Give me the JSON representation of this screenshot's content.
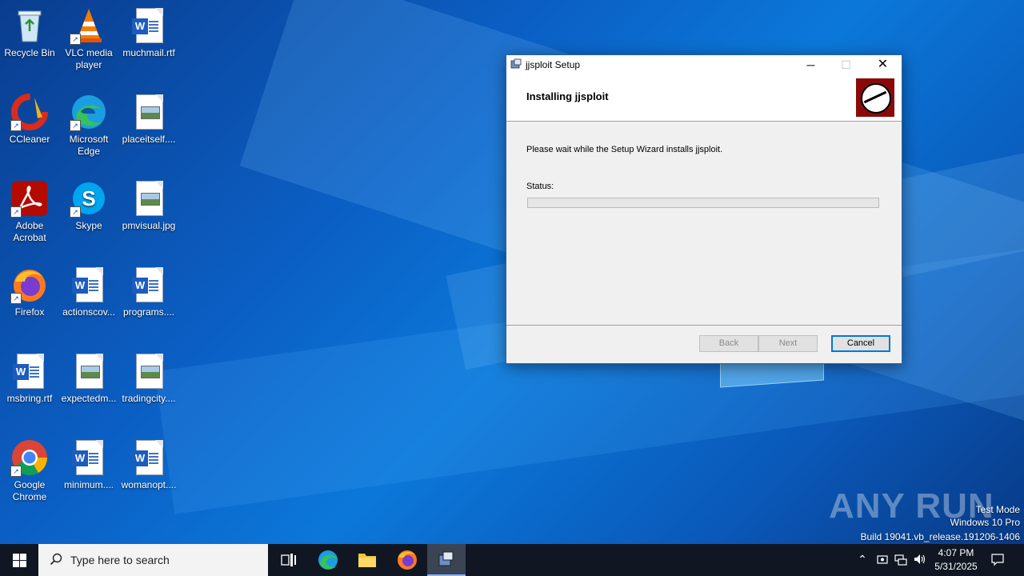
{
  "desktop": {
    "icons": [
      {
        "label": "Recycle Bin",
        "icon": "recycle-bin-icon"
      },
      {
        "label": "VLC media player",
        "icon": "vlc-icon"
      },
      {
        "label": "muchmail.rtf",
        "icon": "word-doc-icon"
      },
      {
        "label": "CCleaner",
        "icon": "ccleaner-icon"
      },
      {
        "label": "Microsoft Edge",
        "icon": "edge-icon"
      },
      {
        "label": "placeitself....",
        "icon": "image-file-icon"
      },
      {
        "label": "Adobe Acrobat",
        "icon": "acrobat-icon"
      },
      {
        "label": "Skype",
        "icon": "skype-icon"
      },
      {
        "label": "pmvisual.jpg",
        "icon": "image-file-icon"
      },
      {
        "label": "Firefox",
        "icon": "firefox-icon"
      },
      {
        "label": "actionscov...",
        "icon": "word-doc-icon"
      },
      {
        "label": "programs....",
        "icon": "word-doc-icon"
      },
      {
        "label": "msbring.rtf",
        "icon": "word-doc-icon"
      },
      {
        "label": "expectedm...",
        "icon": "image-file-icon"
      },
      {
        "label": "tradingcity....",
        "icon": "image-file-icon"
      },
      {
        "label": "Google Chrome",
        "icon": "chrome-icon"
      },
      {
        "label": "minimum....",
        "icon": "word-doc-icon"
      },
      {
        "label": "womanopt....",
        "icon": "word-doc-icon"
      }
    ]
  },
  "window": {
    "title": "jjsploit Setup",
    "header_title": "Installing jjsploit",
    "body_text": "Please wait while the Setup Wizard installs jjsploit.",
    "status_label": "Status:",
    "progress_fraction": 0,
    "buttons": {
      "back": "Back",
      "next": "Next",
      "cancel": "Cancel"
    }
  },
  "watermark": {
    "brand": "ANY RUN",
    "line1": "Test Mode",
    "line2": "Windows 10 Pro",
    "line3": "Build 19041.vb_release.191206-1406"
  },
  "taskbar": {
    "search_placeholder": "Type here to search",
    "time": "4:07 PM",
    "date": "5/31/2025"
  },
  "colors": {
    "accent": "#0078d7",
    "taskbar": "#101722",
    "logo_red": "#8a0a0a"
  }
}
